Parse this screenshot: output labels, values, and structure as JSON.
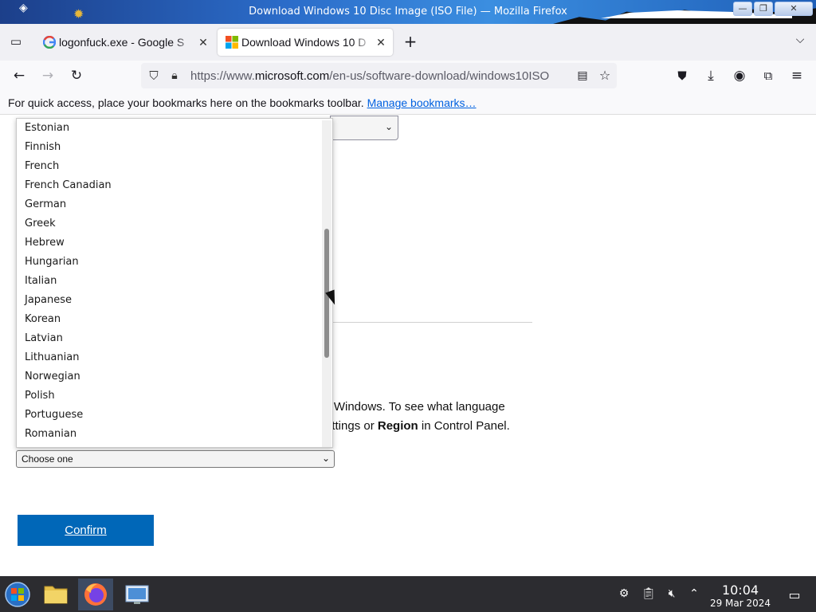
{
  "window": {
    "title": "Download Windows 10 Disc Image (ISO File) — Mozilla Firefox",
    "controls": {
      "minimize": "—",
      "maximize": "❐",
      "close": "✕"
    }
  },
  "tabs": [
    {
      "label": "logonfuck.exe - Google S",
      "icon": "google-g-icon",
      "close": "✕"
    },
    {
      "label": "Download Windows 10 D",
      "icon": "windows-logo-icon",
      "close": "✕"
    }
  ],
  "new_tab": "+",
  "tab_list_chevron": "⌵",
  "nav": {
    "url_prefix": "https://www.",
    "url_domain": "microsoft.com",
    "url_path": "/en-us/software-download/windows10ISO"
  },
  "bookmarks_bar": {
    "message": "For quick access, place your bookmarks here on the bookmarks toolbar.",
    "link": "Manage bookmarks…"
  },
  "page": {
    "paragraph": {
      "line1": "ll Windows. To see what language",
      "line2_part1": "ettings or ",
      "line2_bold": "Region",
      "line2_part2": " in Control Panel."
    },
    "language_select": {
      "value": "Choose one"
    },
    "language_options": [
      "Estonian",
      "Finnish",
      "French",
      "French Canadian",
      "German",
      "Greek",
      "Hebrew",
      "Hungarian",
      "Italian",
      "Japanese",
      "Korean",
      "Latvian",
      "Lithuanian",
      "Norwegian",
      "Polish",
      "Portuguese",
      "Romanian"
    ],
    "confirm_label": "Confirm"
  },
  "taskbar": {
    "time": "10:04",
    "date": "29 Mar 2024"
  },
  "colors": {
    "accent": "#0067b8",
    "link": "#0061e0",
    "taskbar": "#2c2c30"
  }
}
